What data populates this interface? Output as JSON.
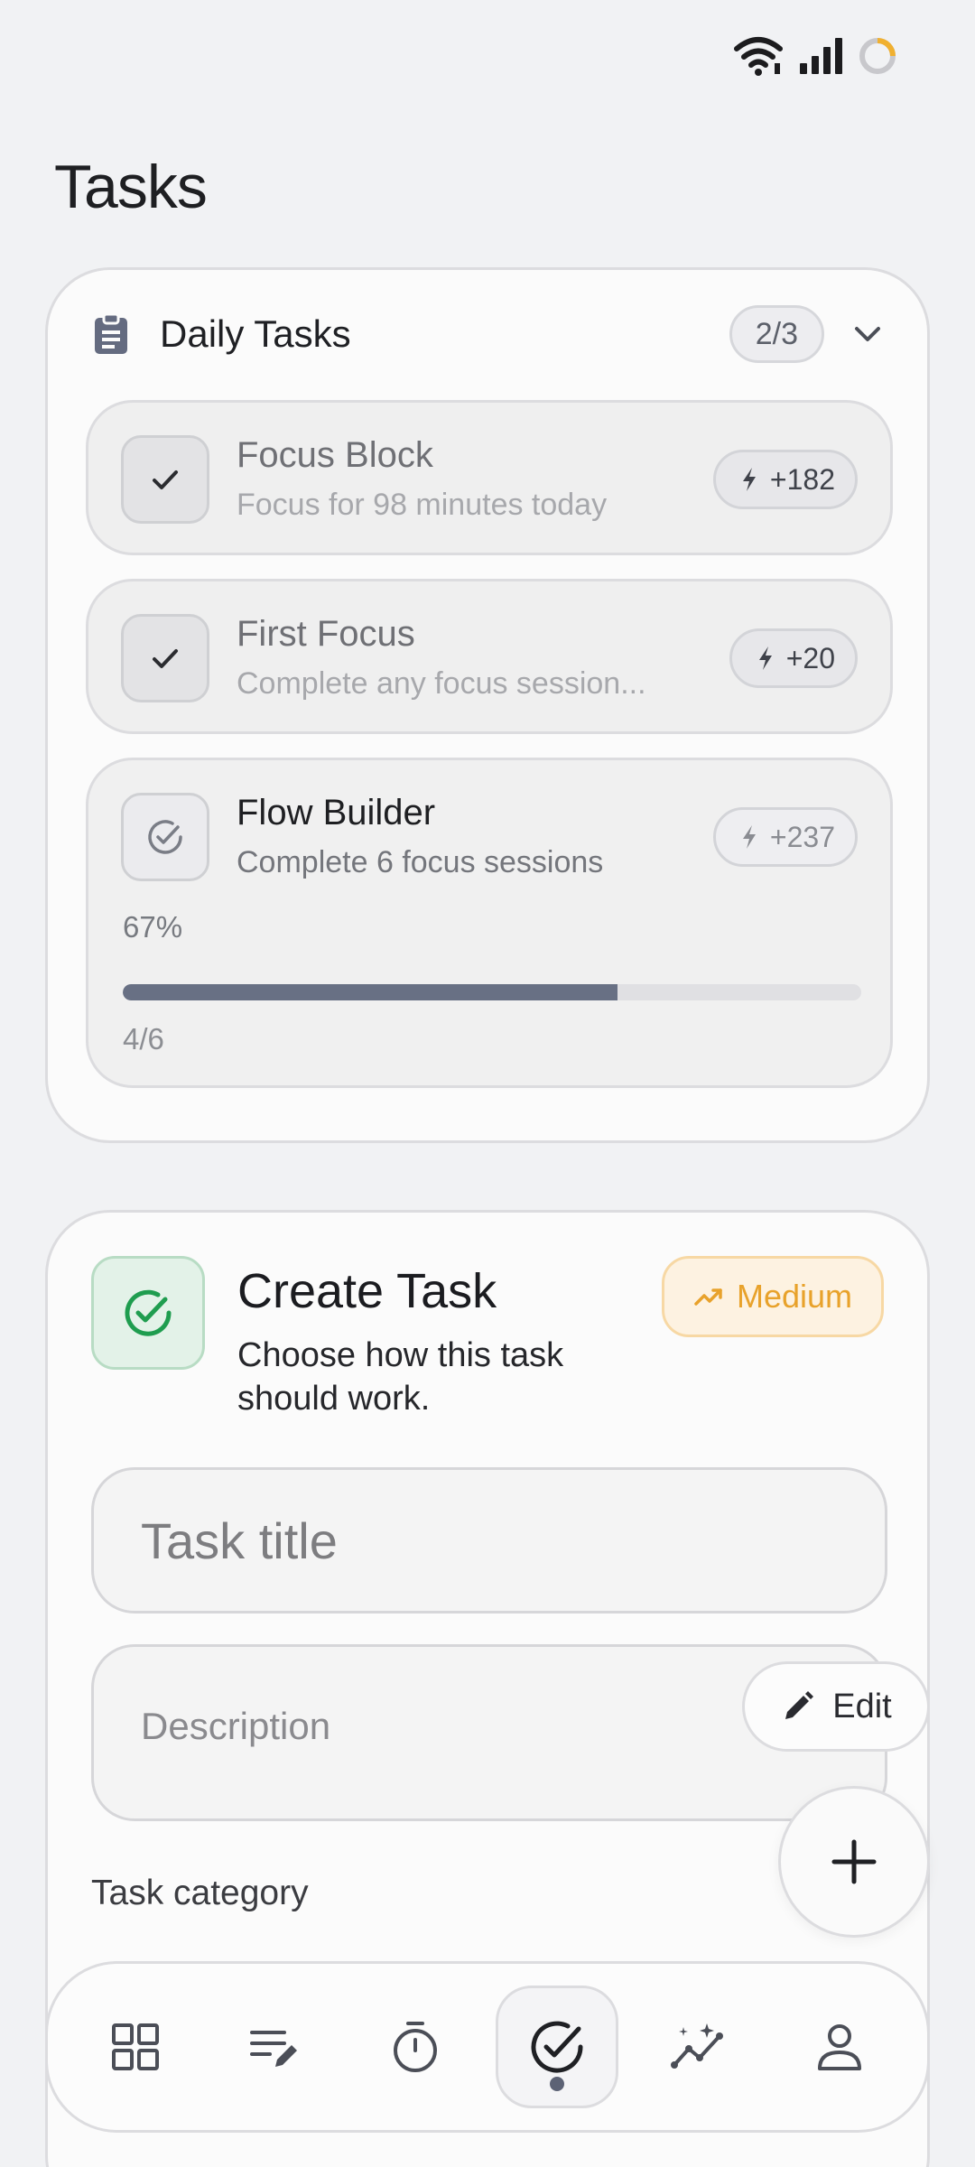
{
  "page": {
    "title": "Tasks"
  },
  "daily": {
    "title": "Daily Tasks",
    "count": "2/3",
    "tasks": [
      {
        "title": "Focus Block",
        "subtitle": "Focus for 98 minutes today",
        "xp": "+182",
        "done": true
      },
      {
        "title": "First Focus",
        "subtitle": "Complete any focus session...",
        "xp": "+20",
        "done": true
      },
      {
        "title": "Flow Builder",
        "subtitle": "Complete 6 focus sessions",
        "xp": "+237",
        "done": false,
        "progress_pct_label": "67%",
        "progress_fraction": 0.67,
        "progress_count": "4/6"
      }
    ]
  },
  "create": {
    "title": "Create Task",
    "subtitle": "Choose how this task should work.",
    "priority": "Medium",
    "title_placeholder": "Task title",
    "description_placeholder": "Description",
    "category_label": "Task category"
  },
  "fab": {
    "edit_label": "Edit"
  },
  "colors": {
    "accent_green": "#1f9d4f",
    "priority_orange": "#e8a22b",
    "progress": "#687084"
  },
  "nav": [
    "dashboard-icon",
    "notes-icon",
    "timer-icon",
    "tasks-icon",
    "insights-icon",
    "profile-icon"
  ]
}
